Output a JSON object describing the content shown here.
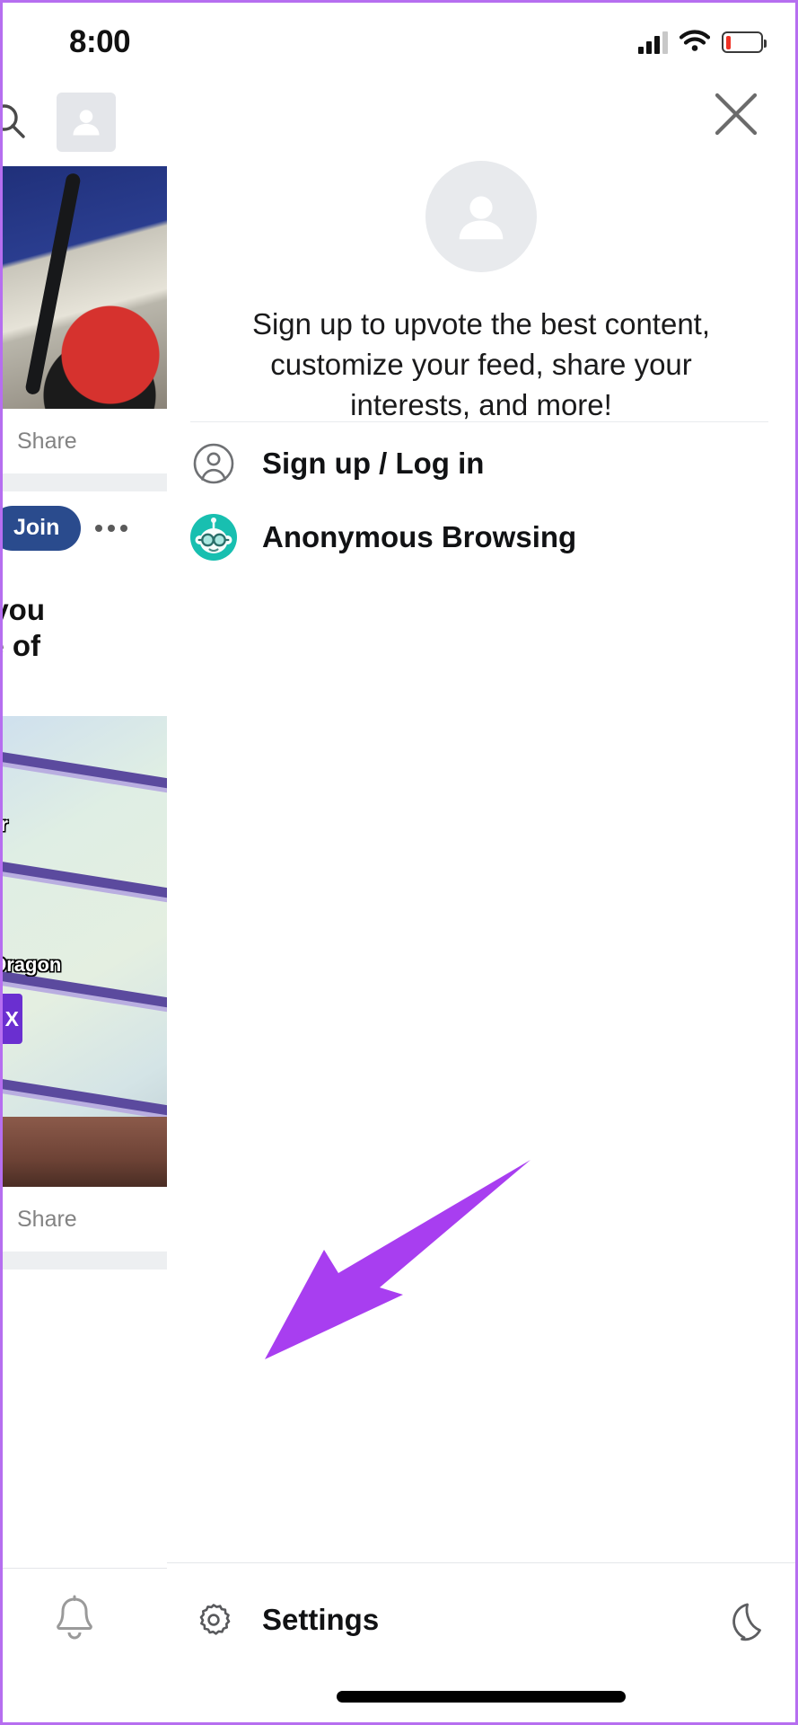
{
  "status_bar": {
    "time": "8:00",
    "signal_icon": "cellular-signal-icon",
    "wifi_icon": "wifi-icon",
    "battery_icon": "battery-low-icon",
    "battery_level_percent": 15
  },
  "background_feed": {
    "search_icon": "search-icon",
    "avatar_icon": "avatar-placeholder-icon",
    "post_one": {
      "share_label": "Share",
      "join_label": "Join",
      "overflow_icon": "more-options-icon"
    },
    "post_two": {
      "title_line_1": "ut you",
      "title_line_2": "ate of",
      "image_label_1": "wer",
      "image_label_2": "e Dragon",
      "image_badge": "X",
      "share_label": "Share"
    },
    "notification_icon": "bell-icon"
  },
  "drawer": {
    "close_icon": "close-icon",
    "avatar_icon": "avatar-placeholder-icon",
    "headline": "Sign up to upvote the best content, customize your feed, share your interests, and more!",
    "menu_items": [
      {
        "label": "Sign up / Log in",
        "icon": "user-circle-icon"
      },
      {
        "label": "Anonymous Browsing",
        "icon": "snoo-incognito-icon"
      }
    ]
  },
  "bottom_bar": {
    "settings_label": "Settings",
    "settings_icon": "gear-icon",
    "night_mode_icon": "moon-icon",
    "home_indicator": "home-indicator"
  },
  "annotation": {
    "arrow_icon": "pointer-arrow-icon",
    "arrow_color": "#a83ef0",
    "points_at": "Settings"
  },
  "colors": {
    "accent_purple": "#b66ef0",
    "snoo_teal": "#18bfb0",
    "join_blue": "#2a4b8d",
    "battery_red": "#ef3124",
    "text_primary": "#1a1a1b",
    "text_muted": "#838383"
  }
}
